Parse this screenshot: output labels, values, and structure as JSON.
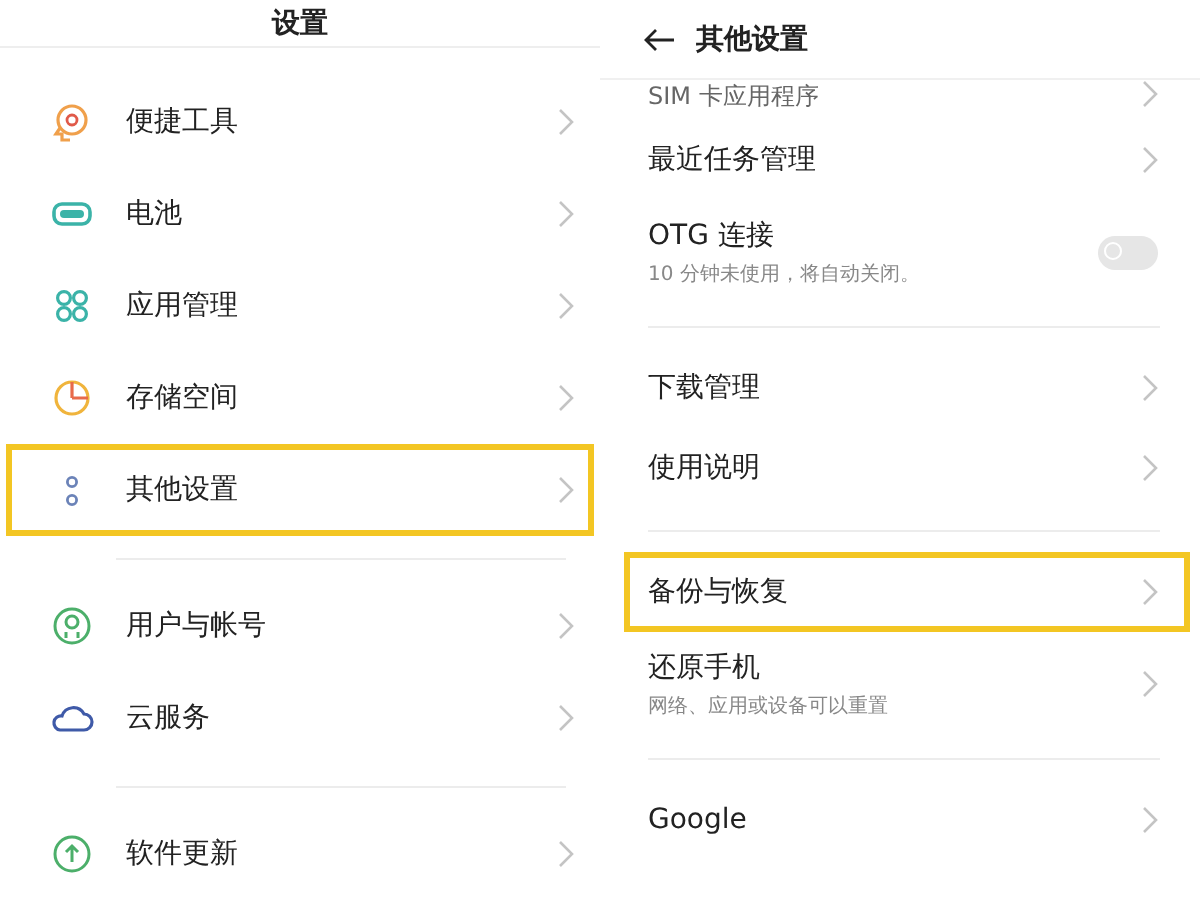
{
  "left_pane": {
    "title": "设置",
    "groups": [
      {
        "items": [
          {
            "label": "便捷工具",
            "kind": "tools",
            "highlighted": false
          },
          {
            "label": "电池",
            "kind": "battery",
            "highlighted": false
          },
          {
            "label": "应用管理",
            "kind": "apps",
            "highlighted": false
          },
          {
            "label": "存储空间",
            "kind": "storage",
            "highlighted": false
          },
          {
            "label": "其他设置",
            "kind": "more",
            "highlighted": true
          }
        ]
      },
      {
        "items": [
          {
            "label": "用户与帐号",
            "kind": "user",
            "highlighted": false
          },
          {
            "label": "云服务",
            "kind": "cloud",
            "highlighted": false
          }
        ]
      },
      {
        "items": [
          {
            "label": "软件更新",
            "kind": "update",
            "highlighted": false
          }
        ]
      }
    ]
  },
  "right_pane": {
    "title": "其他设置",
    "groups": [
      {
        "items": [
          {
            "kind": "cut",
            "label": "SIM 卡应用程序",
            "highlighted": false
          },
          {
            "kind": "link",
            "label": "最近任务管理",
            "highlighted": false
          },
          {
            "kind": "toggle",
            "label": "OTG 连接",
            "subtitle": "10 分钟未使用，将自动关闭。",
            "on": false,
            "highlighted": false
          }
        ]
      },
      {
        "items": [
          {
            "kind": "link",
            "label": "下载管理",
            "highlighted": false
          },
          {
            "kind": "link",
            "label": "使用说明",
            "highlighted": false
          }
        ]
      },
      {
        "items": [
          {
            "kind": "link",
            "label": "备份与恢复",
            "highlighted": true
          },
          {
            "kind": "link",
            "label": "还原手机",
            "subtitle": "网络、应用或设备可以重置",
            "highlighted": false
          }
        ]
      },
      {
        "items": [
          {
            "kind": "link",
            "label": "Google",
            "highlighted": false
          }
        ]
      }
    ]
  }
}
